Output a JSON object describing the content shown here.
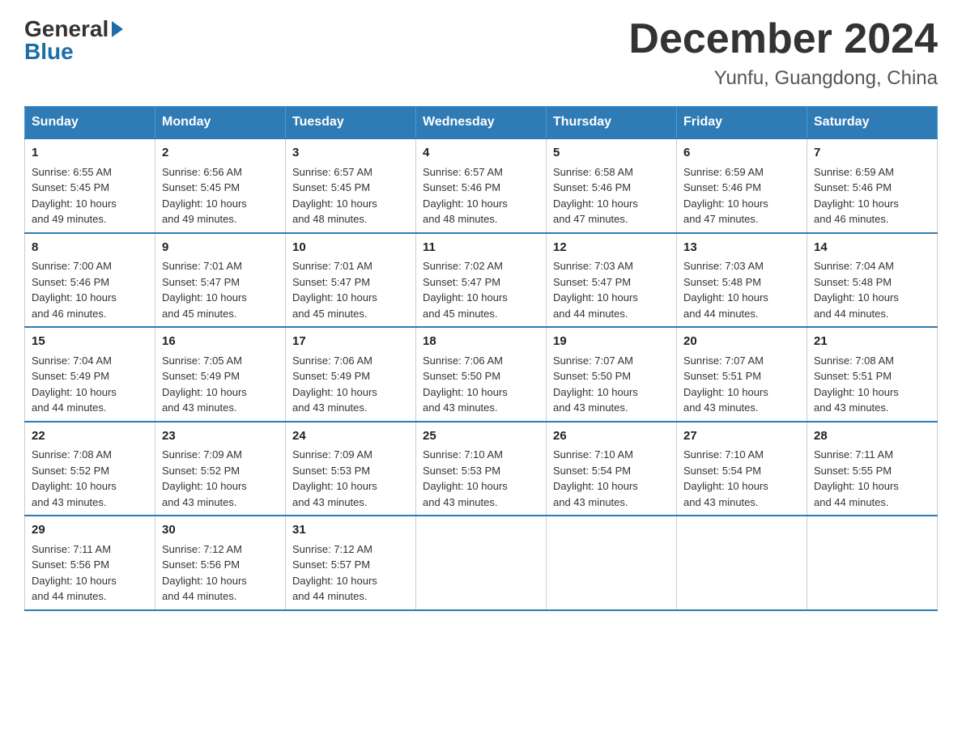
{
  "logo": {
    "general": "General",
    "blue": "Blue"
  },
  "title": "December 2024",
  "subtitle": "Yunfu, Guangdong, China",
  "headers": [
    "Sunday",
    "Monday",
    "Tuesday",
    "Wednesday",
    "Thursday",
    "Friday",
    "Saturday"
  ],
  "weeks": [
    [
      {
        "day": "1",
        "sunrise": "6:55 AM",
        "sunset": "5:45 PM",
        "daylight": "10 hours and 49 minutes."
      },
      {
        "day": "2",
        "sunrise": "6:56 AM",
        "sunset": "5:45 PM",
        "daylight": "10 hours and 49 minutes."
      },
      {
        "day": "3",
        "sunrise": "6:57 AM",
        "sunset": "5:45 PM",
        "daylight": "10 hours and 48 minutes."
      },
      {
        "day": "4",
        "sunrise": "6:57 AM",
        "sunset": "5:46 PM",
        "daylight": "10 hours and 48 minutes."
      },
      {
        "day": "5",
        "sunrise": "6:58 AM",
        "sunset": "5:46 PM",
        "daylight": "10 hours and 47 minutes."
      },
      {
        "day": "6",
        "sunrise": "6:59 AM",
        "sunset": "5:46 PM",
        "daylight": "10 hours and 47 minutes."
      },
      {
        "day": "7",
        "sunrise": "6:59 AM",
        "sunset": "5:46 PM",
        "daylight": "10 hours and 46 minutes."
      }
    ],
    [
      {
        "day": "8",
        "sunrise": "7:00 AM",
        "sunset": "5:46 PM",
        "daylight": "10 hours and 46 minutes."
      },
      {
        "day": "9",
        "sunrise": "7:01 AM",
        "sunset": "5:47 PM",
        "daylight": "10 hours and 45 minutes."
      },
      {
        "day": "10",
        "sunrise": "7:01 AM",
        "sunset": "5:47 PM",
        "daylight": "10 hours and 45 minutes."
      },
      {
        "day": "11",
        "sunrise": "7:02 AM",
        "sunset": "5:47 PM",
        "daylight": "10 hours and 45 minutes."
      },
      {
        "day": "12",
        "sunrise": "7:03 AM",
        "sunset": "5:47 PM",
        "daylight": "10 hours and 44 minutes."
      },
      {
        "day": "13",
        "sunrise": "7:03 AM",
        "sunset": "5:48 PM",
        "daylight": "10 hours and 44 minutes."
      },
      {
        "day": "14",
        "sunrise": "7:04 AM",
        "sunset": "5:48 PM",
        "daylight": "10 hours and 44 minutes."
      }
    ],
    [
      {
        "day": "15",
        "sunrise": "7:04 AM",
        "sunset": "5:49 PM",
        "daylight": "10 hours and 44 minutes."
      },
      {
        "day": "16",
        "sunrise": "7:05 AM",
        "sunset": "5:49 PM",
        "daylight": "10 hours and 43 minutes."
      },
      {
        "day": "17",
        "sunrise": "7:06 AM",
        "sunset": "5:49 PM",
        "daylight": "10 hours and 43 minutes."
      },
      {
        "day": "18",
        "sunrise": "7:06 AM",
        "sunset": "5:50 PM",
        "daylight": "10 hours and 43 minutes."
      },
      {
        "day": "19",
        "sunrise": "7:07 AM",
        "sunset": "5:50 PM",
        "daylight": "10 hours and 43 minutes."
      },
      {
        "day": "20",
        "sunrise": "7:07 AM",
        "sunset": "5:51 PM",
        "daylight": "10 hours and 43 minutes."
      },
      {
        "day": "21",
        "sunrise": "7:08 AM",
        "sunset": "5:51 PM",
        "daylight": "10 hours and 43 minutes."
      }
    ],
    [
      {
        "day": "22",
        "sunrise": "7:08 AM",
        "sunset": "5:52 PM",
        "daylight": "10 hours and 43 minutes."
      },
      {
        "day": "23",
        "sunrise": "7:09 AM",
        "sunset": "5:52 PM",
        "daylight": "10 hours and 43 minutes."
      },
      {
        "day": "24",
        "sunrise": "7:09 AM",
        "sunset": "5:53 PM",
        "daylight": "10 hours and 43 minutes."
      },
      {
        "day": "25",
        "sunrise": "7:10 AM",
        "sunset": "5:53 PM",
        "daylight": "10 hours and 43 minutes."
      },
      {
        "day": "26",
        "sunrise": "7:10 AM",
        "sunset": "5:54 PM",
        "daylight": "10 hours and 43 minutes."
      },
      {
        "day": "27",
        "sunrise": "7:10 AM",
        "sunset": "5:54 PM",
        "daylight": "10 hours and 43 minutes."
      },
      {
        "day": "28",
        "sunrise": "7:11 AM",
        "sunset": "5:55 PM",
        "daylight": "10 hours and 44 minutes."
      }
    ],
    [
      {
        "day": "29",
        "sunrise": "7:11 AM",
        "sunset": "5:56 PM",
        "daylight": "10 hours and 44 minutes."
      },
      {
        "day": "30",
        "sunrise": "7:12 AM",
        "sunset": "5:56 PM",
        "daylight": "10 hours and 44 minutes."
      },
      {
        "day": "31",
        "sunrise": "7:12 AM",
        "sunset": "5:57 PM",
        "daylight": "10 hours and 44 minutes."
      },
      null,
      null,
      null,
      null
    ]
  ],
  "labels": {
    "sunrise": "Sunrise:",
    "sunset": "Sunset:",
    "daylight": "Daylight:"
  }
}
